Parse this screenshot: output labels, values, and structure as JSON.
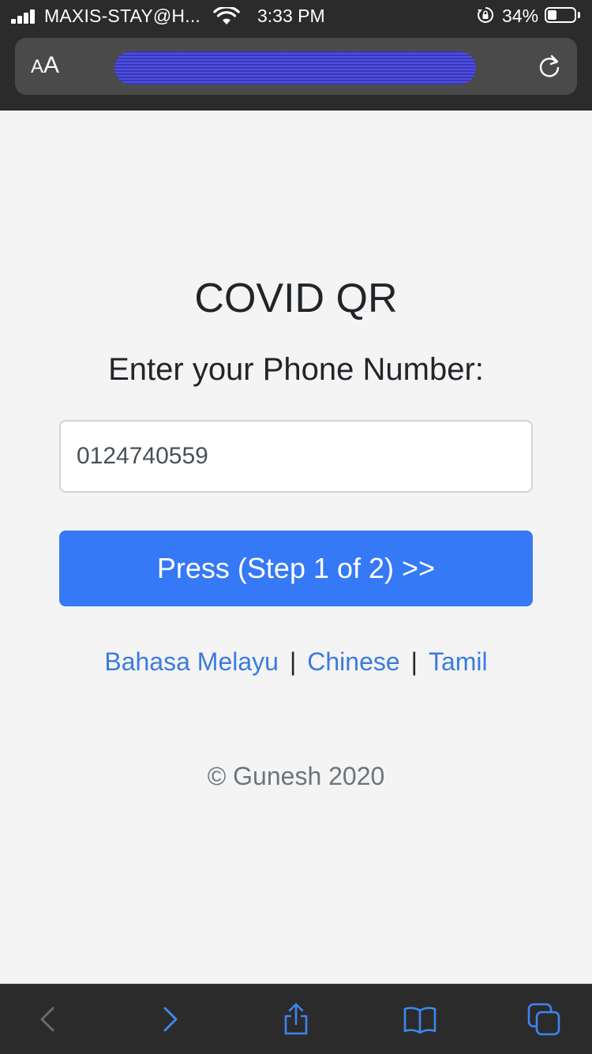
{
  "status_bar": {
    "carrier": "MAXIS-STAY@H...",
    "time": "3:33 PM",
    "battery_percent": "34%",
    "battery_level": 0.34,
    "icons": [
      "signal-icon",
      "wifi-icon",
      "orientation-lock-icon",
      "battery-icon"
    ]
  },
  "browser": {
    "text_size_label_small": "A",
    "text_size_label_big": "A",
    "url_redacted": true,
    "reload_icon": "reload-icon",
    "toolbar_icons": [
      "back-icon",
      "forward-icon",
      "share-icon",
      "bookmarks-icon",
      "tabs-icon"
    ]
  },
  "page": {
    "title": "COVID QR",
    "prompt": "Enter your Phone Number:",
    "phone_value": "0124740559",
    "submit_label": "Press (Step 1 of 2) >>",
    "languages": [
      "Bahasa Melayu",
      "Chinese",
      "Tamil"
    ],
    "separator": "|",
    "footer": "© Gunesh 2020"
  },
  "colors": {
    "accent": "#3579f6",
    "link": "#3a7be0",
    "chrome": "#2b2b2b",
    "background": "#f4f4f4"
  }
}
